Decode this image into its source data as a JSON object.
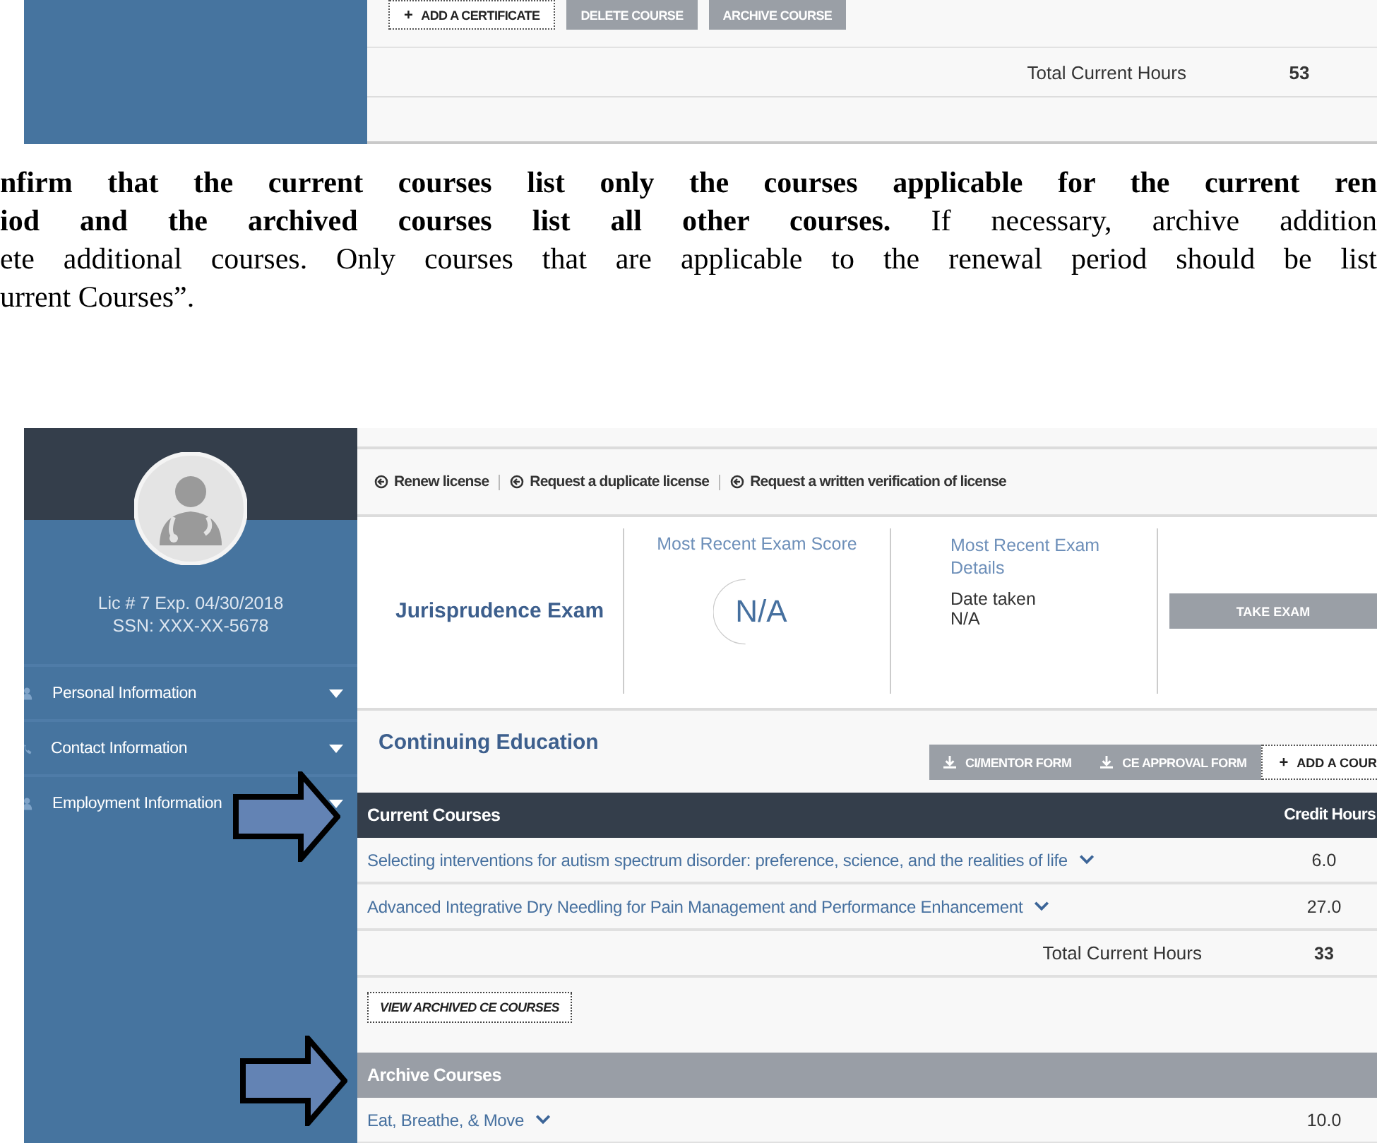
{
  "top_screenshot": {
    "buttons": [
      {
        "kind": "outline",
        "icon": "+",
        "label": "ADD A CERTIFICATE"
      },
      {
        "kind": "gray",
        "label": "DELETE COURSE"
      },
      {
        "kind": "gray",
        "label": "ARCHIVE COURSE"
      }
    ],
    "total": {
      "label": "Total Current Hours",
      "value": "53"
    }
  },
  "instructions": {
    "lines": [
      {
        "kind": "bold",
        "text": "nfirm that the current courses list only the courses applicable for the current ren"
      },
      {
        "kind": "plain",
        "text": "**iod and the archived courses list all other courses.**  If necessary, archive addition"
      },
      {
        "kind": "plain",
        "text": "ete additional courses. Only courses that are applicable to the renewal period should be list"
      },
      {
        "kind": "last",
        "text": "urrent Courses”."
      }
    ]
  },
  "screenshot": {
    "sidebar": {
      "license": "Lic # 7 Exp. 04/30/2018",
      "ssn": "SSN: XXX-XX-5678",
      "menu_items": [
        {
          "kind": "person",
          "label": "Personal Information"
        },
        {
          "kind": "phone",
          "label": "Contact Information"
        },
        {
          "kind": "person",
          "label": "Employment Information"
        }
      ]
    },
    "actions": [
      "Renew license",
      "Request a duplicate license",
      "Request a written verification of license"
    ],
    "exam": {
      "title": "Jurisprudence Exam",
      "score_label": "Most Recent Exam Score",
      "score": "N/A",
      "details_label": "Most Recent Exam Details",
      "date_label": "Date taken",
      "date": "N/A",
      "button": "TAKE EXAM"
    },
    "continuing_education": {
      "title": "Continuing Education",
      "buttons": [
        {
          "kind": "download",
          "label": "CI/MENTOR FORM"
        },
        {
          "kind": "download",
          "label": "CE APPROVAL FORM"
        },
        {
          "kind": "add",
          "icon": "+",
          "label": "ADD A COUR"
        }
      ]
    },
    "current_courses": {
      "title": "Current Courses",
      "hours_header": "Credit Hours",
      "rows": [
        {
          "title": "Selecting interventions for autism spectrum disorder: preference, science, and the realities of life",
          "hours": "6.0"
        },
        {
          "title": "Advanced Integrative Dry Needling for Pain Management and Performance Enhancement",
          "hours": "27.0"
        }
      ],
      "total": {
        "label": "Total Current Hours",
        "value": "33"
      }
    },
    "view_archived": "VIEW ARCHIVED CE COURSES",
    "archive_courses": {
      "title": "Archive Courses",
      "rows": [
        {
          "title": "Eat, Breathe, & Move",
          "hours": "10.0"
        }
      ]
    }
  }
}
